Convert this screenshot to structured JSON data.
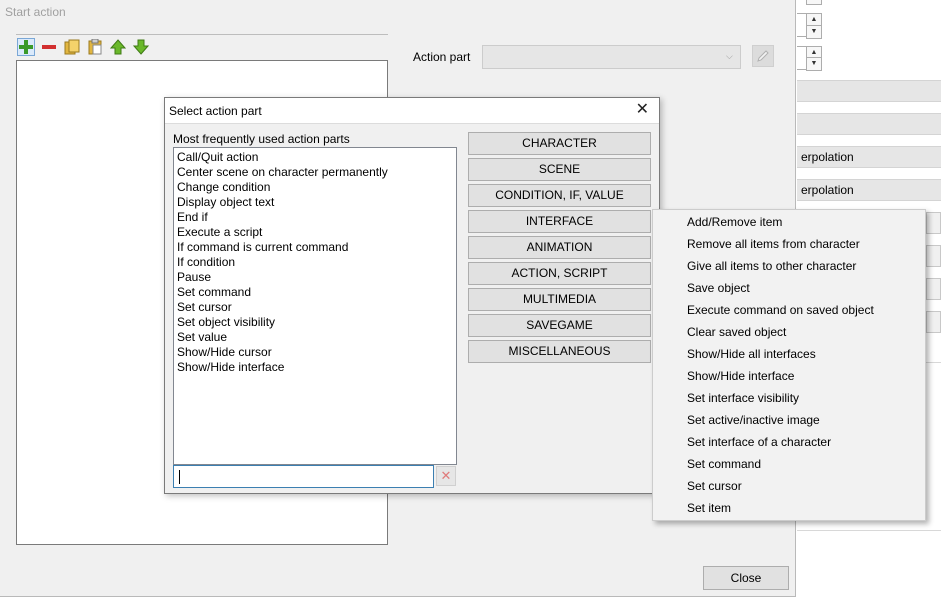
{
  "main_window": {
    "title": "Start action",
    "action_part_label": "Action part",
    "action_part_value": "",
    "close_label": "Close",
    "toolbar": [
      "add-icon",
      "remove-icon",
      "copy-icon",
      "paste-icon",
      "move-up-icon",
      "move-down-icon"
    ]
  },
  "background_window": {
    "bar_1": "",
    "bar_2": "",
    "bar_3": "erpolation",
    "bar_4": "erpolation"
  },
  "dialog": {
    "title": "Select action part",
    "close_glyph": "✕",
    "frequent_label": "Most frequently used action parts",
    "frequent_items": [
      "Call/Quit action",
      "Center scene on character permanently",
      "Change condition",
      "Display object text",
      "End if",
      "Execute a script",
      "If command is current command",
      "If condition",
      "Pause",
      "Set command",
      "Set cursor",
      "Set object visibility",
      "Set value",
      "Show/Hide cursor",
      "Show/Hide interface"
    ],
    "search_value": "",
    "clear_glyph": "✕",
    "categories": [
      "CHARACTER",
      "SCENE",
      "CONDITION, IF, VALUE",
      "INTERFACE",
      "ANIMATION",
      "ACTION, SCRIPT",
      "MULTIMEDIA",
      "SAVEGAME",
      "MISCELLANEOUS"
    ]
  },
  "menu": {
    "items": [
      "Add/Remove item",
      "Remove all items from character",
      "Give all items to other character",
      "Save object",
      "Execute command on saved object",
      "Clear saved object",
      "Show/Hide all interfaces",
      "Show/Hide interface",
      "Set interface visibility",
      "Set active/inactive image",
      "Set interface of a character",
      "Set command",
      "Set cursor",
      "Set item"
    ]
  }
}
